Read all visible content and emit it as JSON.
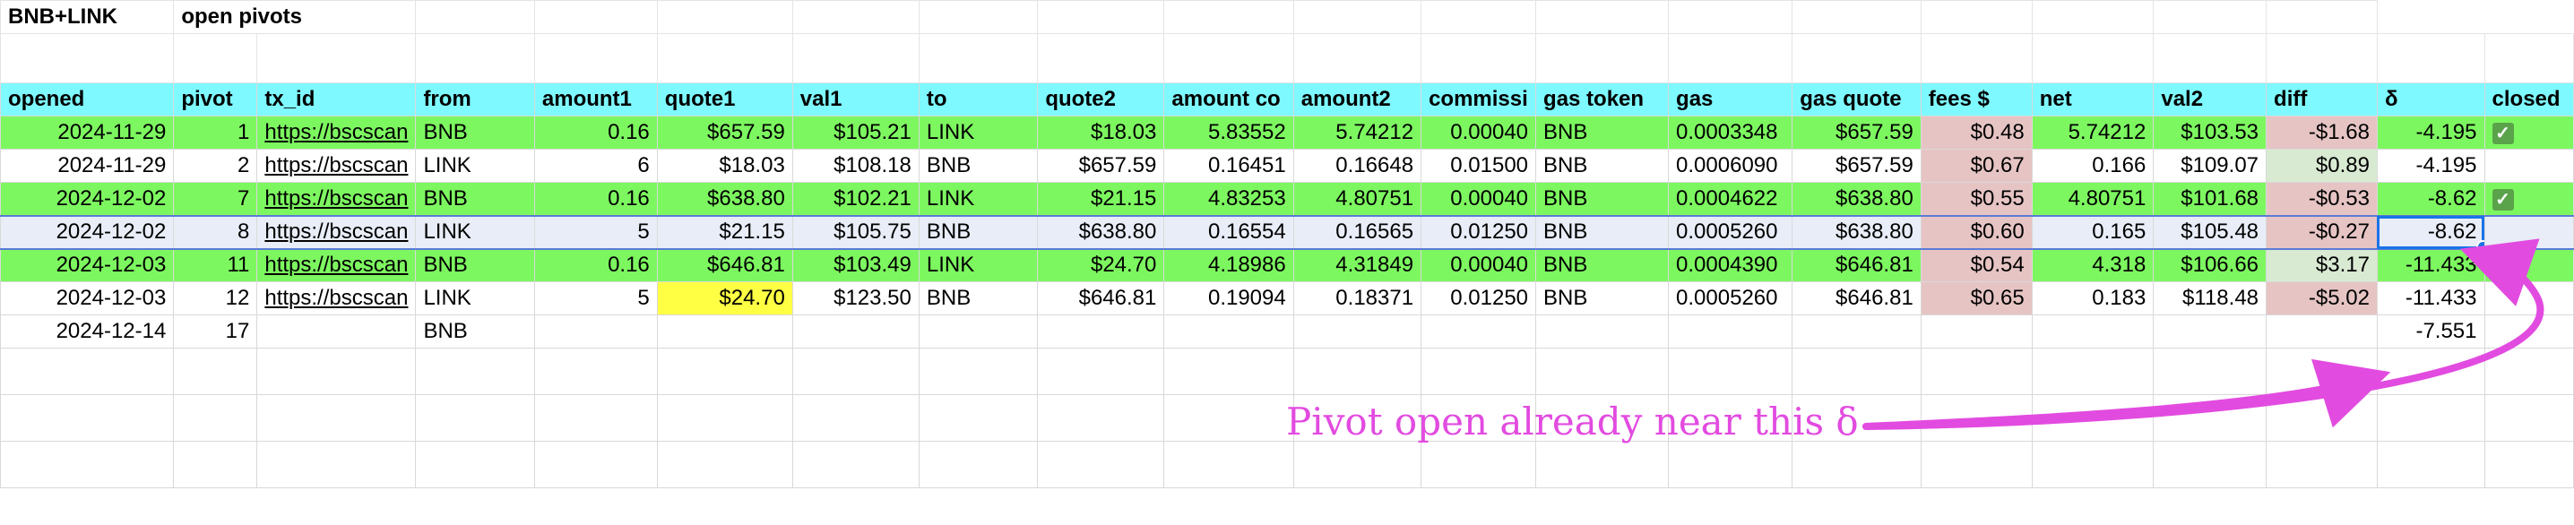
{
  "sheet": {
    "title": "BNB+LINK",
    "subtitle": "open pivots",
    "columns": [
      "opened",
      "pivot",
      "tx_id",
      "from",
      "amount1",
      "quote1",
      "val1",
      "to",
      "quote2",
      "amount co",
      "amount2",
      "commissi",
      "gas token",
      "gas",
      "gas quote",
      "fees $",
      "net",
      "val2",
      "diff",
      "δ",
      "closed"
    ],
    "rows": [
      {
        "opened": "2024-11-29",
        "pivot": "1",
        "tx_id": "https://bscscan",
        "from": "BNB",
        "amount1": "0.16",
        "quote1": "$657.59",
        "val1": "$105.21",
        "to": "LINK",
        "quote2": "$18.03",
        "amount_co": "5.83552",
        "amount2": "5.74212",
        "commission": "0.00040",
        "gas_token": "BNB",
        "gas": "0.0003348",
        "gas_quote": "$657.59",
        "fees": "$0.48",
        "net": "5.74212",
        "val2": "$103.53",
        "diff": "-$1.68",
        "delta": "-4.195",
        "closed": "✓"
      },
      {
        "opened": "2024-11-29",
        "pivot": "2",
        "tx_id": "https://bscscan",
        "from": "LINK",
        "amount1": "6",
        "quote1": "$18.03",
        "val1": "$108.18",
        "to": "BNB",
        "quote2": "$657.59",
        "amount_co": "0.16451",
        "amount2": "0.16648",
        "commission": "0.01500",
        "gas_token": "BNB",
        "gas": "0.0006090",
        "gas_quote": "$657.59",
        "fees": "$0.67",
        "net": "0.166",
        "val2": "$109.07",
        "diff": "$0.89",
        "delta": "-4.195",
        "closed": ""
      },
      {
        "opened": "2024-12-02",
        "pivot": "7",
        "tx_id": "https://bscscan",
        "from": "BNB",
        "amount1": "0.16",
        "quote1": "$638.80",
        "val1": "$102.21",
        "to": "LINK",
        "quote2": "$21.15",
        "amount_co": "4.83253",
        "amount2": "4.80751",
        "commission": "0.00040",
        "gas_token": "BNB",
        "gas": "0.0004622",
        "gas_quote": "$638.80",
        "fees": "$0.55",
        "net": "4.80751",
        "val2": "$101.68",
        "diff": "-$0.53",
        "delta": "-8.62",
        "closed": "✓"
      },
      {
        "opened": "2024-12-02",
        "pivot": "8",
        "tx_id": "https://bscscan",
        "from": "LINK",
        "amount1": "5",
        "quote1": "$21.15",
        "val1": "$105.75",
        "to": "BNB",
        "quote2": "$638.80",
        "amount_co": "0.16554",
        "amount2": "0.16565",
        "commission": "0.01250",
        "gas_token": "BNB",
        "gas": "0.0005260",
        "gas_quote": "$638.80",
        "fees": "$0.60",
        "net": "0.165",
        "val2": "$105.48",
        "diff": "-$0.27",
        "delta": "-8.62",
        "closed": ""
      },
      {
        "opened": "2024-12-03",
        "pivot": "11",
        "tx_id": "https://bscscan",
        "from": "BNB",
        "amount1": "0.16",
        "quote1": "$646.81",
        "val1": "$103.49",
        "to": "LINK",
        "quote2": "$24.70",
        "amount_co": "4.18986",
        "amount2": "4.31849",
        "commission": "0.00040",
        "gas_token": "BNB",
        "gas": "0.0004390",
        "gas_quote": "$646.81",
        "fees": "$0.54",
        "net": "4.318",
        "val2": "$106.66",
        "diff": "$3.17",
        "delta": "-11.433",
        "closed": "✓"
      },
      {
        "opened": "2024-12-03",
        "pivot": "12",
        "tx_id": "https://bscscan",
        "from": "LINK",
        "amount1": "5",
        "quote1": "$24.70",
        "val1": "$123.50",
        "to": "BNB",
        "quote2": "$646.81",
        "amount_co": "0.19094",
        "amount2": "0.18371",
        "commission": "0.01250",
        "gas_token": "BNB",
        "gas": "0.0005260",
        "gas_quote": "$646.81",
        "fees": "$0.65",
        "net": "0.183",
        "val2": "$118.48",
        "diff": "-$5.02",
        "delta": "-11.433",
        "closed": ""
      },
      {
        "opened": "2024-12-14",
        "pivot": "17",
        "tx_id": "",
        "from": "BNB",
        "amount1": "",
        "quote1": "",
        "val1": "",
        "to": "",
        "quote2": "",
        "amount_co": "",
        "amount2": "",
        "commission": "",
        "gas_token": "",
        "gas": "",
        "gas_quote": "",
        "fees": "",
        "net": "",
        "val2": "",
        "diff": "",
        "delta": "-7.551",
        "closed": ""
      }
    ]
  },
  "annotation": {
    "text": "Pivot open already near this δ",
    "color": "#e24be0"
  },
  "colors": {
    "header_bg": "#7ef9ff",
    "green_row": "#7df760",
    "fees_bg": "#e6c4c4",
    "diff_pos_bg": "#d9ead3",
    "highlight": "#ffff44",
    "selection": "#1a73e8"
  }
}
